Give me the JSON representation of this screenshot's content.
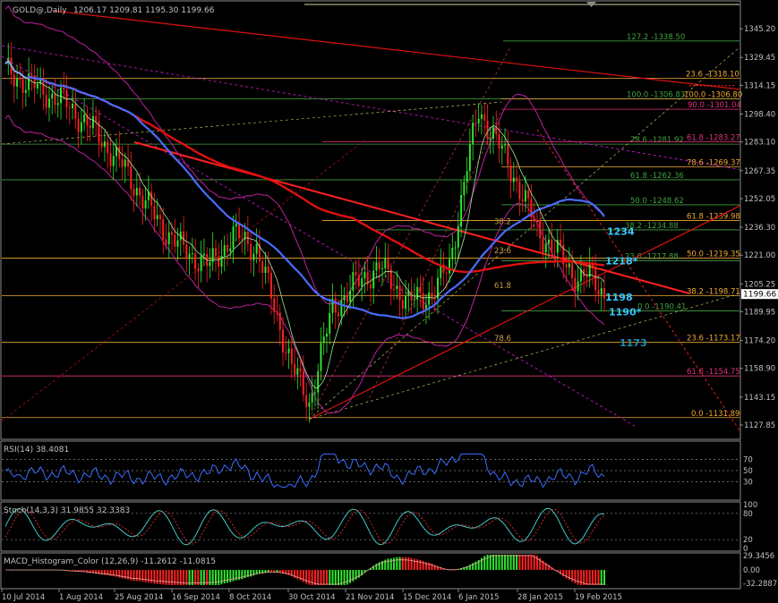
{
  "chart_data": {
    "type": "candlestick",
    "symbol": "GOLD@,Daily",
    "ohlc_header": "1206.17 1209.81 1195.30 1199.66",
    "last_price": 1199.66,
    "ylim": [
      1120,
      1360
    ],
    "y_ticks": [
      1345.2,
      1329.45,
      1314.15,
      1298.4,
      1283.1,
      1267.35,
      1252.05,
      1236.3,
      1221.0,
      1205.25,
      1189.95,
      1174.2,
      1158.9,
      1143.15,
      1127.85
    ],
    "x_ticks": [
      "10 Jul 2014",
      "1 Aug 2014",
      "25 Aug 2014",
      "16 Sep 2014",
      "8 Oct 2014",
      "30 Oct 2014",
      "21 Nov 2014",
      "15 Dec 2014",
      "6 Jan 2015",
      "28 Jan 2015",
      "19 Feb 2015"
    ],
    "levels": [
      {
        "label": "127.2 -1338.50",
        "value": 1338.5,
        "color": "#3fa13f"
      },
      {
        "label": "23.6 -1318.10",
        "value": 1318.1,
        "color": "#f0a830"
      },
      {
        "label": "100.0 -1306.83",
        "value": 1306.83,
        "color": "#3fa13f"
      },
      {
        "label": "100.0 -1306.80",
        "value": 1306.8,
        "color": "#f0a830"
      },
      {
        "label": "90.0 -1301.04",
        "value": 1301.04,
        "color": "#e0307a"
      },
      {
        "label": "78.6 -1281.92",
        "value": 1281.92,
        "color": "#3fa13f"
      },
      {
        "label": "61.8 -1283.27",
        "value": 1283.27,
        "color": "#e0307a"
      },
      {
        "label": "78.6 -1269.37",
        "value": 1269.37,
        "color": "#f0a830"
      },
      {
        "label": "61.8 -1262.36",
        "value": 1262.36,
        "color": "#3fa13f"
      },
      {
        "label": "50.0 -1248.62",
        "value": 1248.62,
        "color": "#3fa13f"
      },
      {
        "label": "61.8 -1239.98",
        "value": 1239.98,
        "color": "#f0a830"
      },
      {
        "label": "38.2 -1234.88",
        "value": 1234.88,
        "color": "#3fa13f"
      },
      {
        "label": "50.0 -1219.35",
        "value": 1219.35,
        "color": "#f0a830"
      },
      {
        "label": "23.6 -1217.88",
        "value": 1217.88,
        "color": "#3fa13f"
      },
      {
        "label": "38.2 -1198.71",
        "value": 1198.71,
        "color": "#f0a830"
      },
      {
        "label": "0.0 -1190.41",
        "value": 1190.41,
        "color": "#3fa13f"
      },
      {
        "label": "23.6 -1173.17",
        "value": 1173.17,
        "color": "#f0a830"
      },
      {
        "label": "61.8 -1154.75",
        "value": 1154.75,
        "color": "#e0307a"
      },
      {
        "label": "0.0 -1131.89",
        "value": 1131.89,
        "color": "#f0a830"
      }
    ],
    "annotations": [
      {
        "text": "1234",
        "value": 1234,
        "color": "#39c6ff"
      },
      {
        "text": "1218*",
        "value": 1218,
        "color": "#39c6ff"
      },
      {
        "text": "1198",
        "value": 1198,
        "color": "#39c6ff"
      },
      {
        "text": "1190*",
        "value": 1190,
        "color": "#39c6ff"
      },
      {
        "text": "1173",
        "value": 1173,
        "color": "#1e90b8"
      }
    ],
    "inner_fib_labels": [
      "38.2",
      "23.6",
      "61.8",
      "78.6"
    ],
    "rsi": {
      "label": "RSI(14) 38.4081",
      "value": 38.4081,
      "ylim": [
        0,
        100
      ],
      "ticks": [
        70,
        50,
        30
      ]
    },
    "stoch": {
      "label": "Stoch(14,3,3) 31.9855 32.3383",
      "k": 31.9855,
      "d": 32.3383,
      "ylim": [
        0,
        100
      ],
      "ticks": [
        100,
        80,
        20,
        0
      ]
    },
    "macd": {
      "label": "MACD_Histogram_Color (12,26,9) -11.2612 -11.0815",
      "ylim": [
        -35,
        35
      ],
      "ticks": [
        "29.3456",
        "0.00",
        "-32.2887"
      ]
    },
    "colors": {
      "up": "#2ee62e",
      "down": "#ff2020",
      "ma_long": "#e01010",
      "ma_mid": "#4a6cff",
      "bands": "#c020a0",
      "axis": "#8a8a8a",
      "grid": "#333333"
    }
  }
}
